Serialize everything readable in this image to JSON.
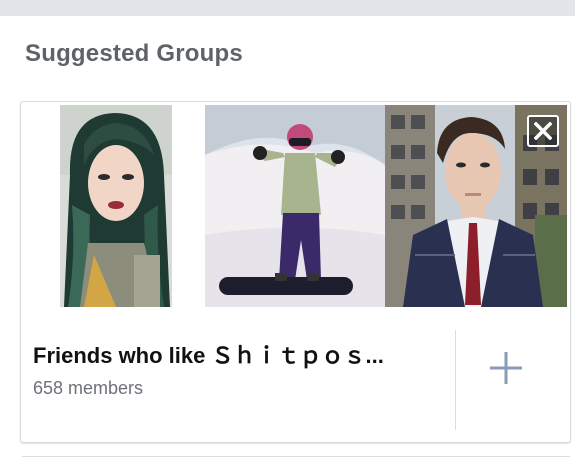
{
  "section": {
    "title": "Suggested Groups"
  },
  "group_card": {
    "name": "Friends who like Ｓｈｉｔｐｏｓ...",
    "members": "658 members",
    "photos": [
      {
        "label": "member-photo-1"
      },
      {
        "label": "member-photo-2"
      },
      {
        "label": "member-photo-3"
      }
    ],
    "close_icon": "close-icon",
    "add_icon": "plus-icon"
  },
  "colors": {
    "title": "#5f6368",
    "text": "#111111",
    "secondary": "#6d7178",
    "plus": "#8a9bb8"
  }
}
